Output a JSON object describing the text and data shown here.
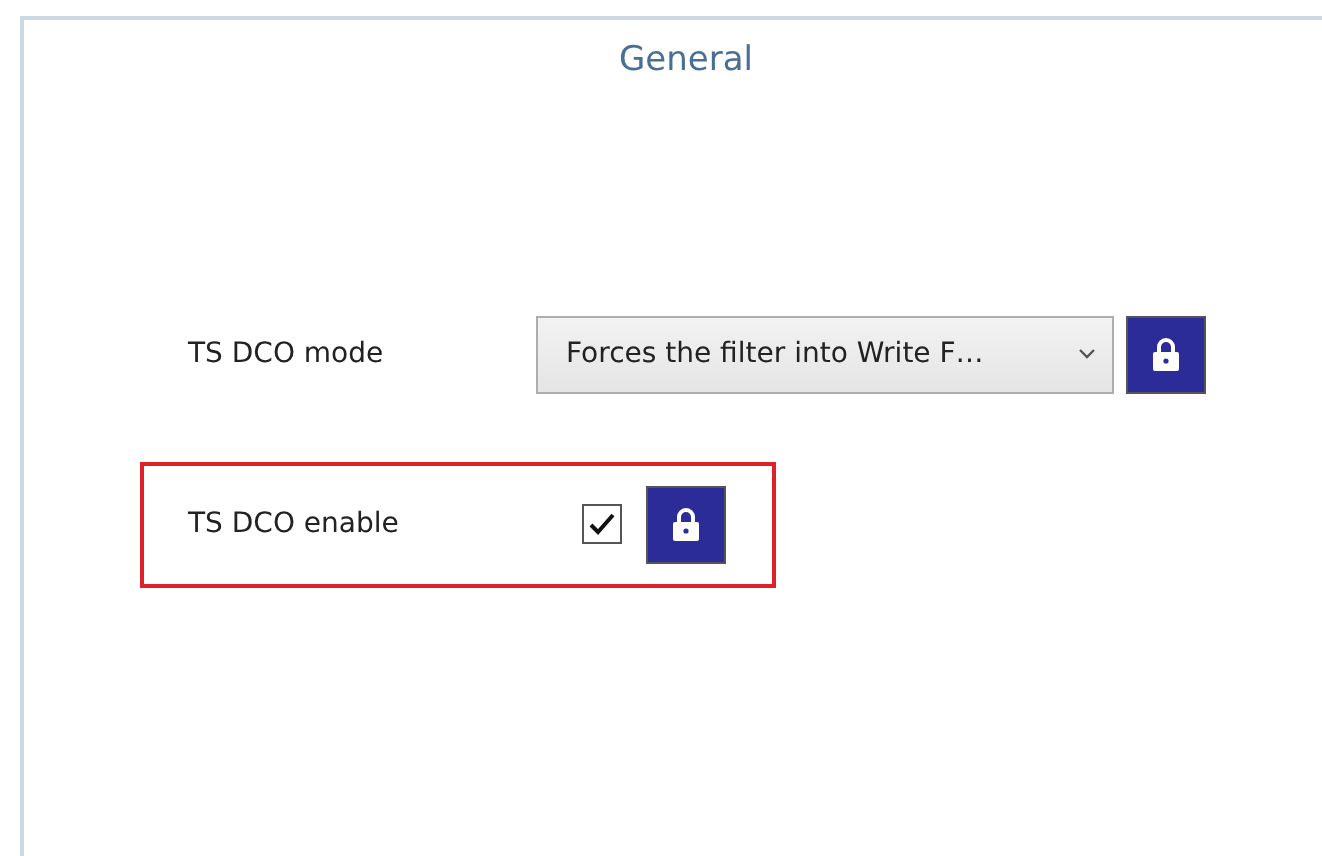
{
  "panel": {
    "title": "General"
  },
  "settings": [
    {
      "kind": "dropdown",
      "label": "TS DCO mode",
      "value": "Forces the filter into Write F…",
      "highlighted": false
    },
    {
      "kind": "checkbox",
      "label": "TS DCO enable",
      "checked": true,
      "highlighted": true
    }
  ]
}
